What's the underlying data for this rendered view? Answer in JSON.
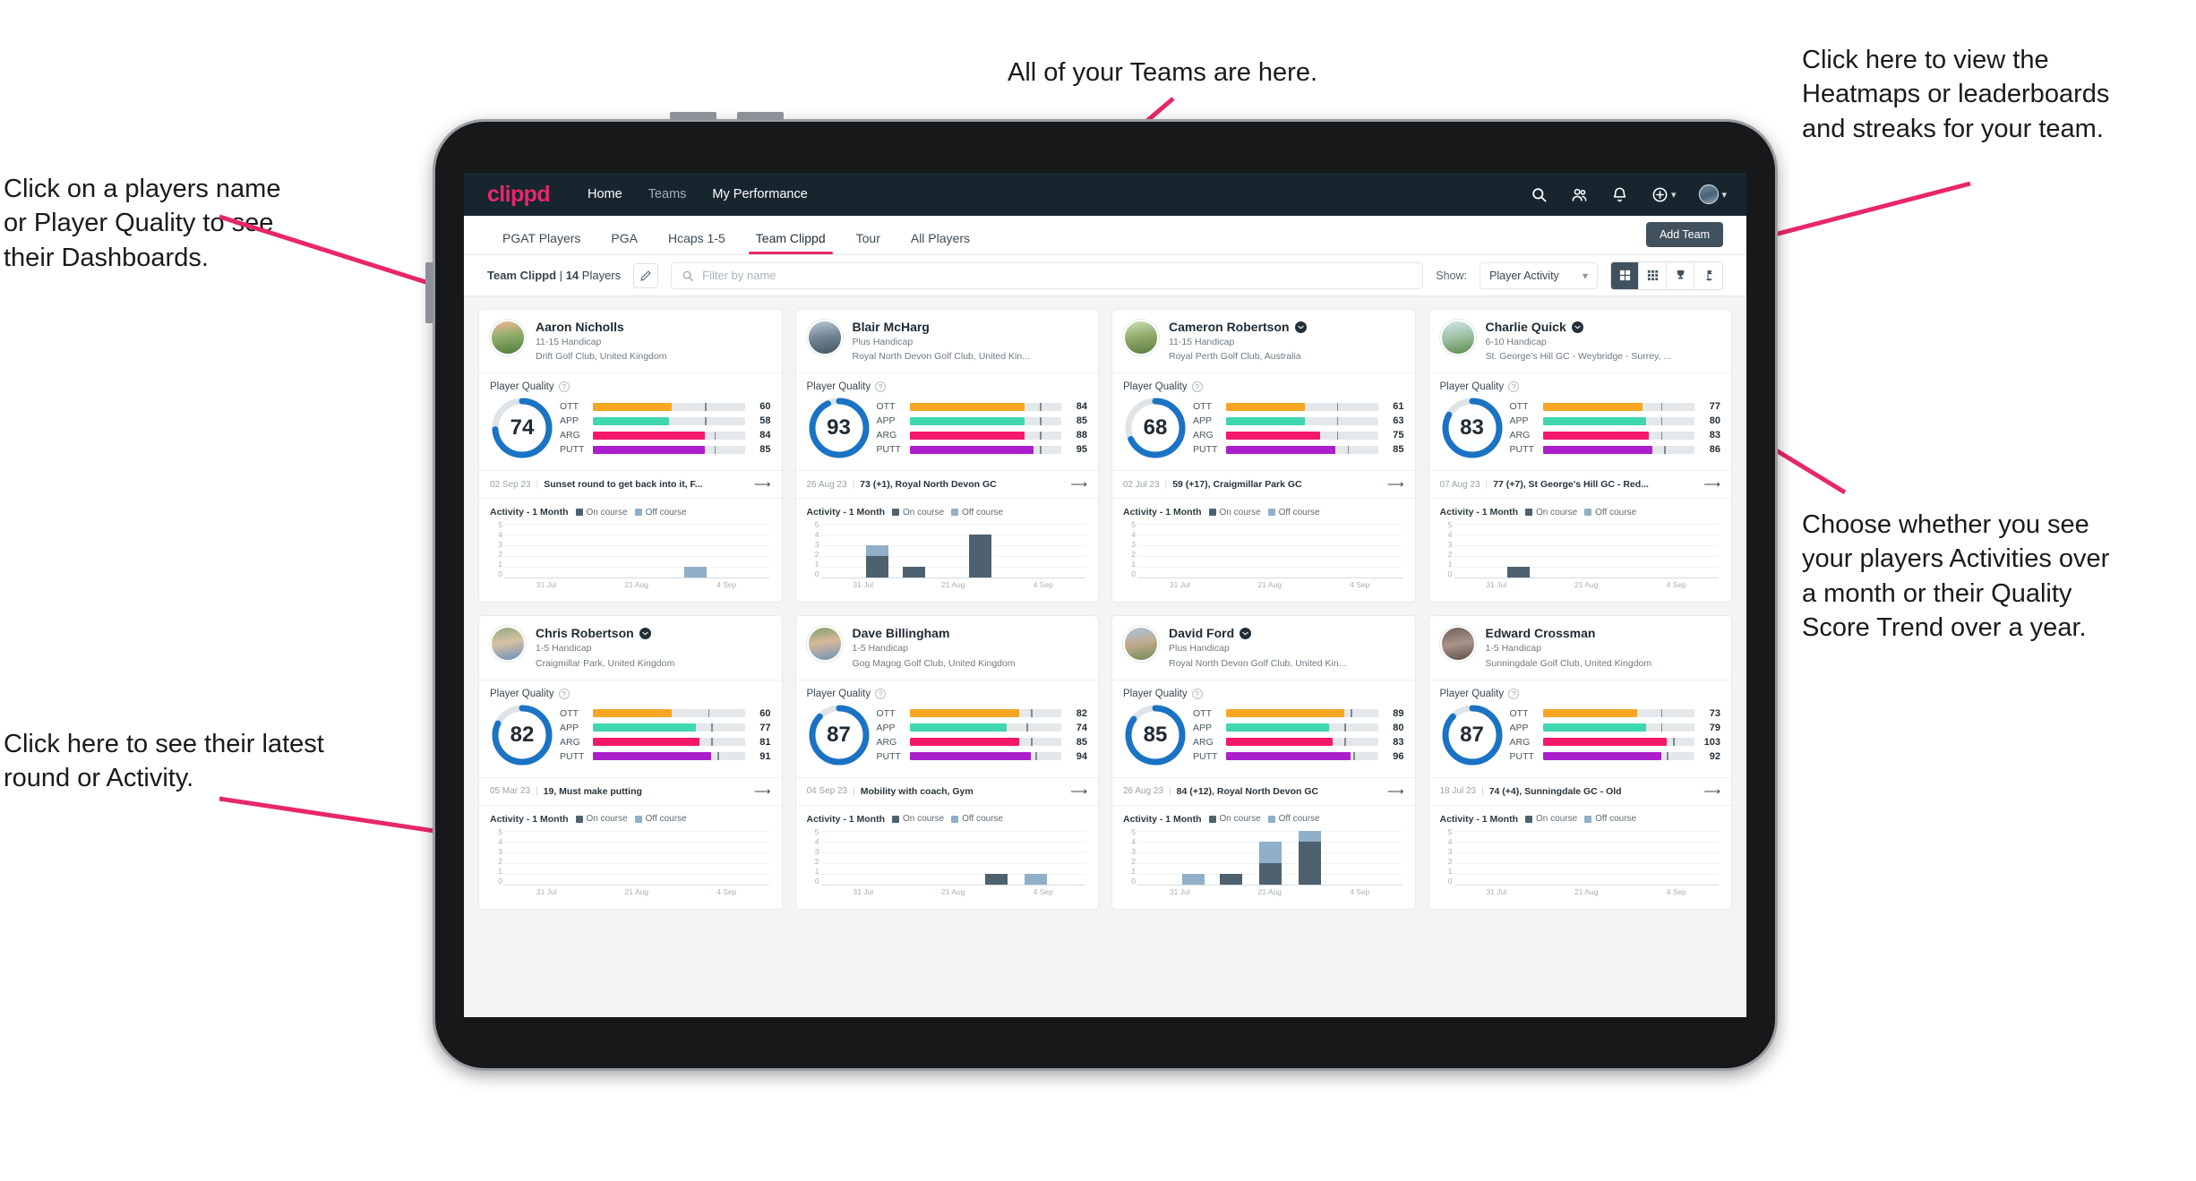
{
  "annotations": [
    {
      "id": "players-name",
      "text": "Click on a players name\nor Player Quality to see\ntheir Dashboards."
    },
    {
      "id": "teams",
      "text": "All of your Teams are here."
    },
    {
      "id": "heatmaps",
      "text": "Click here to view the\nHeatmaps or leaderboards\nand streaks for your team."
    },
    {
      "id": "activity-choice",
      "text": "Choose whether you see\nyour players Activities over\na month or their Quality\nScore Trend over a year."
    },
    {
      "id": "latest-round",
      "text": "Click here to see their latest\nround or Activity."
    }
  ],
  "app": {
    "logo": "clippd",
    "nav_links": [
      {
        "label": "Home",
        "active": true
      },
      {
        "label": "Teams",
        "active": false
      },
      {
        "label": "My Performance",
        "active": true
      }
    ],
    "nav_icons": [
      "search-icon",
      "people-icon",
      "bell-icon",
      "plus-circle-icon",
      "avatar"
    ],
    "tabs": [
      {
        "label": "PGAT Players",
        "active": false
      },
      {
        "label": "PGA",
        "active": false
      },
      {
        "label": "Hcaps 1-5",
        "active": false
      },
      {
        "label": "Team Clippd",
        "active": true
      },
      {
        "label": "Tour",
        "active": false
      },
      {
        "label": "All Players",
        "active": false
      }
    ],
    "add_team_label": "Add Team",
    "toolbar": {
      "team_name": "Team Clippd",
      "team_separator": "|",
      "player_count": "14",
      "players_word": "Players",
      "edit_icon": "pencil-icon",
      "search_placeholder": "Filter by name",
      "search_value": "",
      "show_label": "Show:",
      "show_value": "Player Activity",
      "show_options": [
        "Player Activity",
        "Quality Score Trend"
      ],
      "views": [
        {
          "icon": "grid-view-icon",
          "active": true
        },
        {
          "icon": "dense-grid-icon",
          "active": false
        },
        {
          "icon": "trophy-icon",
          "active": false
        },
        {
          "icon": "golf-flag-icon",
          "active": false
        }
      ]
    },
    "card_labels": {
      "player_quality": "Player Quality",
      "activity": "Activity - 1 Month",
      "legend_on": "On course",
      "legend_off": "Off course"
    },
    "colors": {
      "brand_pink": "#e8276b",
      "navbar": "#17252f",
      "ring": "#1a73c4",
      "ott": "#f5a623",
      "app": "#3fd6b0",
      "arg": "#f5186b",
      "putt": "#ab1ecb",
      "on_course": "#4e616e",
      "off_course": "#90afc8"
    }
  },
  "chart_data": {
    "type": "bar",
    "title": "Activity - 1 Month",
    "ylabel": "",
    "ylim": [
      0,
      5
    ],
    "yticks": [
      "5",
      "4",
      "3",
      "2",
      "1",
      "0"
    ],
    "xticks": [
      "31 Jul",
      "21 Aug",
      "4 Sep"
    ],
    "series_names": [
      "On course",
      "Off course"
    ],
    "legend_position": "top",
    "grid": true
  },
  "players": [
    {
      "name": "Aaron Nicholls",
      "verified": false,
      "handicap": "11-15 Handicap",
      "club": "Drift Golf Club, United Kingdom",
      "avatar": "linear-gradient(170deg,#f3b69a 0%,#8fae6a 45%,#4e7a3a 100%)",
      "quality": 74,
      "bars": [
        {
          "label": "OTT",
          "value": 60,
          "fill": 52,
          "tick": 74
        },
        {
          "label": "APP",
          "value": 58,
          "fill": 50,
          "tick": 74
        },
        {
          "label": "ARG",
          "value": 84,
          "fill": 74,
          "tick": 80
        },
        {
          "label": "PUTT",
          "value": 85,
          "fill": 74,
          "tick": 80
        }
      ],
      "round": {
        "date": "02 Sep 23",
        "text": "Sunset round to get back into it, F..."
      },
      "activity": [
        {
          "x": 68,
          "on": 0,
          "off": 1
        }
      ]
    },
    {
      "name": "Blair McHarg",
      "verified": false,
      "handicap": "Plus Handicap",
      "club": "Royal North Devon Golf Club, United Kin...",
      "avatar": "linear-gradient(170deg,#b9c9d4 0%,#6f8292 50%,#44565f 100%)",
      "quality": 93,
      "bars": [
        {
          "label": "OTT",
          "value": 84,
          "fill": 76,
          "tick": 86
        },
        {
          "label": "APP",
          "value": 85,
          "fill": 76,
          "tick": 86
        },
        {
          "label": "ARG",
          "value": 88,
          "fill": 76,
          "tick": 86
        },
        {
          "label": "PUTT",
          "value": 95,
          "fill": 82,
          "tick": 86
        }
      ],
      "round": {
        "date": "26 Aug 23",
        "text": "73 (+1), Royal North Devon GC"
      },
      "activity": [
        {
          "x": 17,
          "on": 2,
          "off": 1
        },
        {
          "x": 31,
          "on": 1,
          "off": 0
        },
        {
          "x": 56,
          "on": 4,
          "off": 0
        }
      ]
    },
    {
      "name": "Cameron Robertson",
      "verified": true,
      "handicap": "11-15 Handicap",
      "club": "Royal Perth Golf Club, Australia",
      "avatar": "linear-gradient(170deg,#cfe0b8 0%,#93ad6e 45%,#5c7a3c 100%)",
      "quality": 68,
      "bars": [
        {
          "label": "OTT",
          "value": 61,
          "fill": 52,
          "tick": 73
        },
        {
          "label": "APP",
          "value": 63,
          "fill": 52,
          "tick": 73
        },
        {
          "label": "ARG",
          "value": 75,
          "fill": 62,
          "tick": 73
        },
        {
          "label": "PUTT",
          "value": 85,
          "fill": 72,
          "tick": 80
        }
      ],
      "round": {
        "date": "02 Jul 23",
        "text": "59 (+17), Craigmillar Park GC"
      },
      "activity": []
    },
    {
      "name": "Charlie Quick",
      "verified": true,
      "handicap": "6-10 Handicap",
      "club": "St. George's Hill GC - Weybridge - Surrey, ...",
      "avatar": "linear-gradient(170deg,#cfe4ef 0%,#9dc0a0 50%,#5c8a4c 100%)",
      "quality": 83,
      "bars": [
        {
          "label": "OTT",
          "value": 77,
          "fill": 66,
          "tick": 78
        },
        {
          "label": "APP",
          "value": 80,
          "fill": 68,
          "tick": 78
        },
        {
          "label": "ARG",
          "value": 83,
          "fill": 70,
          "tick": 78
        },
        {
          "label": "PUTT",
          "value": 86,
          "fill": 72,
          "tick": 80
        }
      ],
      "round": {
        "date": "07 Aug 23",
        "text": "77 (+7), St George's Hill GC - Red..."
      },
      "activity": [
        {
          "x": 20,
          "on": 1,
          "off": 0
        }
      ]
    },
    {
      "name": "Chris Robertson",
      "verified": true,
      "handicap": "1-5 Handicap",
      "club": "Craigmillar Park, United Kingdom",
      "avatar": "linear-gradient(170deg,#8fa97c 0%,#d9c0a4 45%,#6b8fb8 100%)",
      "quality": 82,
      "bars": [
        {
          "label": "OTT",
          "value": 60,
          "fill": 52,
          "tick": 76
        },
        {
          "label": "APP",
          "value": 77,
          "fill": 68,
          "tick": 78
        },
        {
          "label": "ARG",
          "value": 81,
          "fill": 70,
          "tick": 78
        },
        {
          "label": "PUTT",
          "value": 91,
          "fill": 78,
          "tick": 82
        }
      ],
      "round": {
        "date": "05 Mar 23",
        "text": "19, Must make putting"
      },
      "activity": []
    },
    {
      "name": "Dave Billingham",
      "verified": false,
      "handicap": "1-5 Handicap",
      "club": "Gog Magog Golf Club, United Kingdom",
      "avatar": "linear-gradient(170deg,#7e9f6b 0%,#d7b99b 45%,#6d91bb 100%)",
      "quality": 87,
      "bars": [
        {
          "label": "OTT",
          "value": 82,
          "fill": 72,
          "tick": 80
        },
        {
          "label": "APP",
          "value": 74,
          "fill": 64,
          "tick": 77
        },
        {
          "label": "ARG",
          "value": 85,
          "fill": 72,
          "tick": 80
        },
        {
          "label": "PUTT",
          "value": 94,
          "fill": 80,
          "tick": 83
        }
      ],
      "round": {
        "date": "04 Sep 23",
        "text": "Mobility with coach, Gym"
      },
      "activity": [
        {
          "x": 62,
          "on": 1,
          "off": 0
        },
        {
          "x": 77,
          "on": 0,
          "off": 1
        }
      ]
    },
    {
      "name": "David Ford",
      "verified": true,
      "handicap": "Plus Handicap",
      "club": "Royal North Devon Golf Club, United Kin...",
      "avatar": "linear-gradient(170deg,#a9c6dd 0%,#c0a98b 50%,#6f8a58 100%)",
      "quality": 85,
      "bars": [
        {
          "label": "OTT",
          "value": 89,
          "fill": 78,
          "tick": 82
        },
        {
          "label": "APP",
          "value": 80,
          "fill": 68,
          "tick": 78
        },
        {
          "label": "ARG",
          "value": 83,
          "fill": 70,
          "tick": 78
        },
        {
          "label": "PUTT",
          "value": 96,
          "fill": 82,
          "tick": 84
        }
      ],
      "round": {
        "date": "26 Aug 23",
        "text": "84 (+12), Royal North Devon GC"
      },
      "activity": [
        {
          "x": 17,
          "on": 0,
          "off": 1
        },
        {
          "x": 31,
          "on": 1,
          "off": 0
        },
        {
          "x": 46,
          "on": 2,
          "off": 2
        },
        {
          "x": 61,
          "on": 4,
          "off": 1
        }
      ]
    },
    {
      "name": "Edward Crossman",
      "verified": false,
      "handicap": "1-5 Handicap",
      "club": "Sunningdale Golf Club, United Kingdom",
      "avatar": "linear-gradient(170deg,#6f6158 0%,#a9938a 50%,#5c5148 100%)",
      "quality": 87,
      "bars": [
        {
          "label": "OTT",
          "value": 73,
          "fill": 62,
          "tick": 78
        },
        {
          "label": "APP",
          "value": 79,
          "fill": 68,
          "tick": 78
        },
        {
          "label": "ARG",
          "value": 103,
          "fill": 82,
          "tick": 86
        },
        {
          "label": "PUTT",
          "value": 92,
          "fill": 78,
          "tick": 82
        }
      ],
      "round": {
        "date": "18 Jul 23",
        "text": "74 (+4), Sunningdale GC - Old"
      },
      "activity": []
    }
  ]
}
